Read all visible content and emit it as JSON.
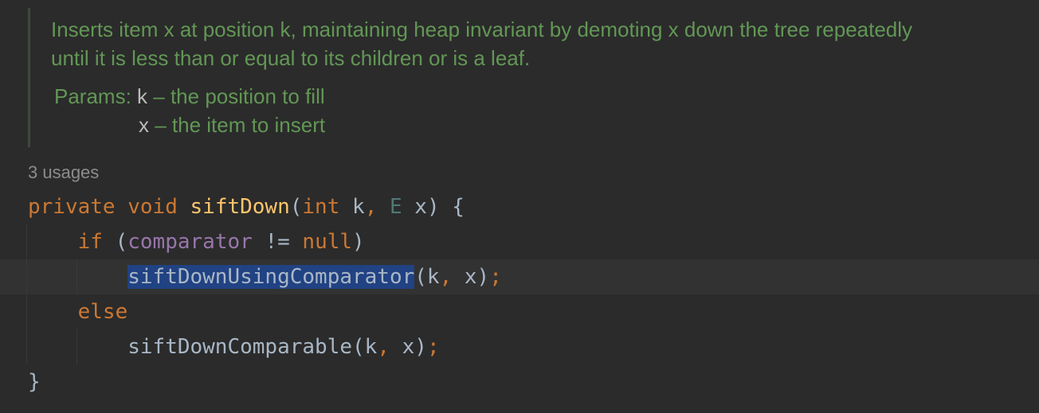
{
  "javadoc": {
    "line1": "Inserts item x at position k, maintaining heap invariant by demoting x down the tree repeatedly",
    "line2": "until it is less than or equal to its children or is a leaf.",
    "params_label": "Params:",
    "params": [
      {
        "name": "k",
        "desc": " – the position to fill"
      },
      {
        "name": "x",
        "desc": " – the item to insert"
      }
    ]
  },
  "usages_hint": "3 usages",
  "code": {
    "line1": {
      "kw_private": "private",
      "kw_void": "void",
      "method": "siftDown",
      "open_paren": "(",
      "kw_int": "int",
      "param_k": " k",
      "comma": ",",
      "type_e": "E",
      "param_x": " x",
      "close_paren_brace": ") {"
    },
    "line2": {
      "kw_if": "if",
      "open_paren": "(",
      "field": "comparator",
      "op": " != ",
      "kw_null": "null",
      "close_paren": ")"
    },
    "line3": {
      "method_selected": "siftDownUsingComparator",
      "args_open": "(k",
      "comma": ",",
      "args_close": " x)",
      "semicolon": ";"
    },
    "line4": {
      "kw_else": "else"
    },
    "line5": {
      "method": "siftDownComparable",
      "args_open": "(k",
      "comma": ",",
      "args_close": " x)",
      "semicolon": ";"
    },
    "line6": {
      "close_brace": "}"
    }
  },
  "colors": {
    "background": "#2b2b2b",
    "doc_text": "#629755",
    "keyword": "#cc7832",
    "method_decl": "#ffc66d",
    "field": "#9876aa",
    "selection": "#214283"
  }
}
